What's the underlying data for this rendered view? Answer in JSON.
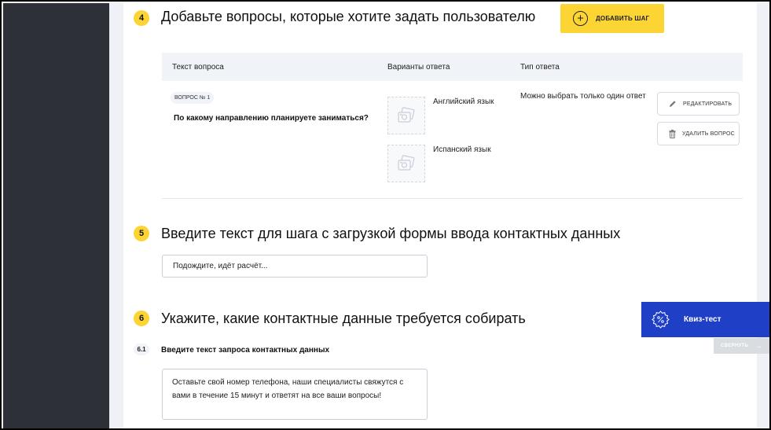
{
  "step4": {
    "number": "4",
    "title": "Добавьте вопросы, которые хотите задать пользователю",
    "add_step_label": "ДОБАВИТЬ ШАГ",
    "table": {
      "headers": [
        "Текст вопроса",
        "Варианты ответа",
        "Тип ответа"
      ],
      "question": {
        "badge": "ВОПРОС № 1",
        "text": "По какому направлению планируете заниматься?",
        "options": [
          "Английский язык",
          "Испанский язык"
        ],
        "answer_type": "Можно выбрать только один ответ",
        "edit_label": "РЕДАКТИРОВАТЬ",
        "delete_label": "УДАЛИТЬ ВОПРОС"
      }
    }
  },
  "step5": {
    "number": "5",
    "title": "Введите текст для шага с загрузкой формы ввода контактных данных",
    "input_value": "Подождите, идёт расчёт..."
  },
  "step6": {
    "number": "6",
    "title": "Укажите, какие контактные данные требуется собирать",
    "sub_number": "6.1",
    "sub_label": "Введите текст запроса контактных данных",
    "textarea_value": "Оставьте свой номер телефона, наши специалисты свяжутся с вами в течение 15 минут и ответят на все ваши вопросы!"
  },
  "quiz_widget": {
    "label": "Квиз-тест",
    "collapse_label": "СВЕРНУТЬ"
  },
  "colors": {
    "accent_yellow": "#fcd535",
    "widget_blue": "#1f3fc7",
    "sidebar_dark": "#2d3036"
  }
}
